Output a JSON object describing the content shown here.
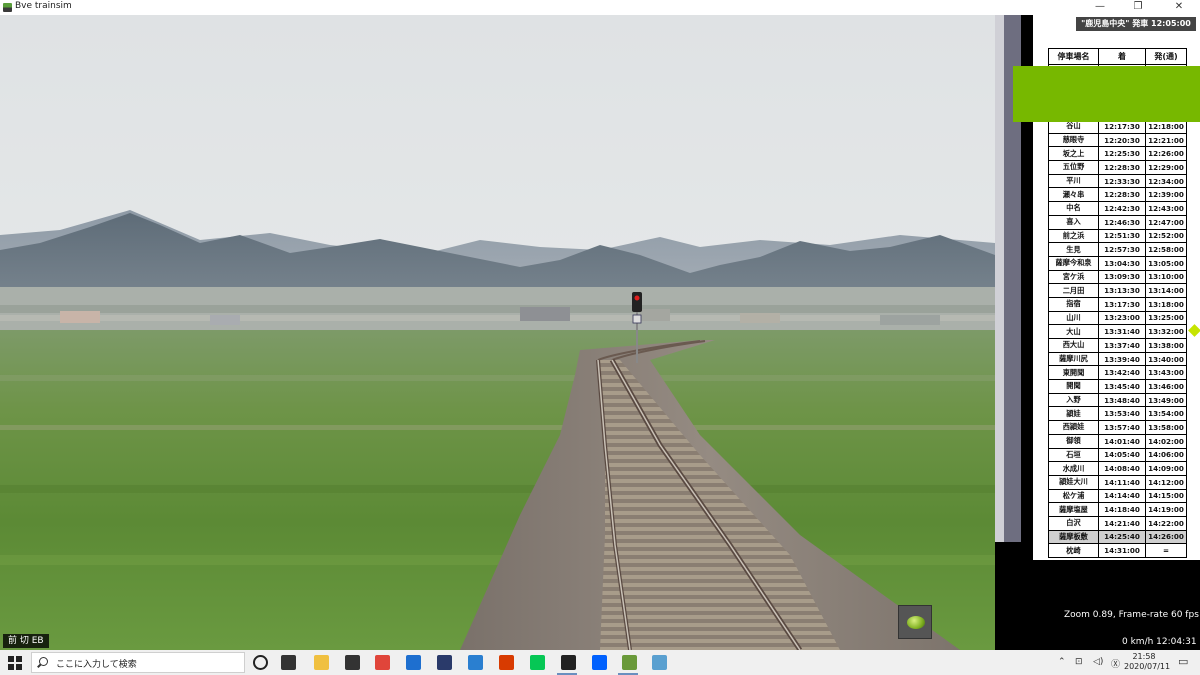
{
  "window": {
    "title": "Bve trainsim",
    "minimize": "—",
    "restore": "❐",
    "close": "✕"
  },
  "timetable": {
    "header": "\"鹿児島中央\" 発車 12:05:00",
    "columns": [
      "停車場名",
      "着",
      "発(通)"
    ],
    "rows": [
      {
        "station": "谷山",
        "arr": "12:17:30",
        "dep": "12:18:00"
      },
      {
        "station": "慈眼寺",
        "arr": "12:20:30",
        "dep": "12:21:00"
      },
      {
        "station": "坂之上",
        "arr": "12:25:30",
        "dep": "12:26:00"
      },
      {
        "station": "五位野",
        "arr": "12:28:30",
        "dep": "12:29:00"
      },
      {
        "station": "平川",
        "arr": "12:33:30",
        "dep": "12:34:00"
      },
      {
        "station": "瀬々串",
        "arr": "12:28:30",
        "dep": "12:39:00"
      },
      {
        "station": "中名",
        "arr": "12:42:30",
        "dep": "12:43:00"
      },
      {
        "station": "喜入",
        "arr": "12:46:30",
        "dep": "12:47:00"
      },
      {
        "station": "前之浜",
        "arr": "12:51:30",
        "dep": "12:52:00"
      },
      {
        "station": "生見",
        "arr": "12:57:30",
        "dep": "12:58:00"
      },
      {
        "station": "薩摩今和泉",
        "arr": "13:04:30",
        "dep": "13:05:00"
      },
      {
        "station": "宮ケ浜",
        "arr": "13:09:30",
        "dep": "13:10:00"
      },
      {
        "station": "二月田",
        "arr": "13:13:30",
        "dep": "13:14:00"
      },
      {
        "station": "指宿",
        "arr": "13:17:30",
        "dep": "13:18:00"
      },
      {
        "station": "山川",
        "arr": "13:23:00",
        "dep": "13:25:00"
      },
      {
        "station": "大山",
        "arr": "13:31:40",
        "dep": "13:32:00"
      },
      {
        "station": "西大山",
        "arr": "13:37:40",
        "dep": "13:38:00"
      },
      {
        "station": "薩摩川尻",
        "arr": "13:39:40",
        "dep": "13:40:00"
      },
      {
        "station": "東開聞",
        "arr": "13:42:40",
        "dep": "13:43:00"
      },
      {
        "station": "開聞",
        "arr": "13:45:40",
        "dep": "13:46:00"
      },
      {
        "station": "入野",
        "arr": "13:48:40",
        "dep": "13:49:00"
      },
      {
        "station": "頴娃",
        "arr": "13:53:40",
        "dep": "13:54:00"
      },
      {
        "station": "西頴娃",
        "arr": "13:57:40",
        "dep": "13:58:00"
      },
      {
        "station": "御領",
        "arr": "14:01:40",
        "dep": "14:02:00"
      },
      {
        "station": "石垣",
        "arr": "14:05:40",
        "dep": "14:06:00"
      },
      {
        "station": "水成川",
        "arr": "14:08:40",
        "dep": "14:09:00"
      },
      {
        "station": "頴娃大川",
        "arr": "14:11:40",
        "dep": "14:12:00"
      },
      {
        "station": "松ケ浦",
        "arr": "14:14:40",
        "dep": "14:15:00"
      },
      {
        "station": "薩摩塩屋",
        "arr": "14:18:40",
        "dep": "14:19:00"
      },
      {
        "station": "白沢",
        "arr": "14:21:40",
        "dep": "14:22:00"
      },
      {
        "station": "薩摩板敷",
        "arr": "14:25:40",
        "dep": "14:26:00",
        "highlight": true
      },
      {
        "station": "枕崎",
        "arr": "14:31:00",
        "dep": "="
      }
    ]
  },
  "hud": {
    "reverser_notch": "前  切  EB",
    "zoom_fps": "Zoom 0.89, Frame-rate 60 fps",
    "speed_time": "0 km/h  12:04:31"
  },
  "taskbar": {
    "search_placeholder": "ここに入力して検索",
    "clock_time": "21:58",
    "clock_date": "2020/07/11",
    "apps": [
      {
        "name": "task-view-icon",
        "color": "#333333"
      },
      {
        "name": "file-explorer-icon",
        "color": "#f0c040"
      },
      {
        "name": "store-icon",
        "color": "#333333"
      },
      {
        "name": "chrome-icon",
        "color": "#e0453a"
      },
      {
        "name": "mail-icon",
        "color": "#1e6fcf"
      },
      {
        "name": "car-app-icon",
        "color": "#2a3a6a"
      },
      {
        "name": "shuttle-icon",
        "color": "#2a7fd0"
      },
      {
        "name": "office-icon",
        "color": "#d83b01"
      },
      {
        "name": "line-icon",
        "color": "#06c755"
      },
      {
        "name": "phone-app-icon",
        "color": "#222222"
      },
      {
        "name": "dropbox-icon",
        "color": "#0061fe"
      },
      {
        "name": "bve-trainsim-icon",
        "color": "#6a9a3a"
      },
      {
        "name": "viewer-icon",
        "color": "#5aa0d0"
      }
    ]
  },
  "colors": {
    "green_block": "#77b800",
    "hud_bg": "#000000",
    "grass": "#5f8a3a",
    "ballast": "#8a7f74"
  }
}
